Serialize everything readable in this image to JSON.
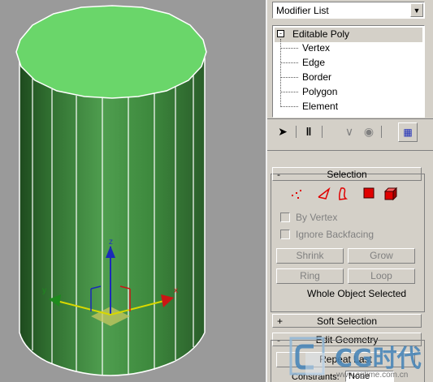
{
  "viewport": {
    "axis_labels": {
      "x": "x",
      "y": "y",
      "z": "z"
    },
    "colors": {
      "object": "#3f8f3f",
      "top": "#6ad66a",
      "background": "#9a9a9a"
    }
  },
  "panel": {
    "modifier_list": {
      "label": "Modifier List"
    },
    "stack": {
      "root": "Editable Poly",
      "items": [
        "Vertex",
        "Edge",
        "Border",
        "Polygon",
        "Element"
      ]
    },
    "toolbar": {
      "icons": [
        "pin-stack-icon",
        "show-end-result-icon",
        "make-unique-icon",
        "remove-modifier-icon",
        "configure-modifier-sets-icon"
      ]
    },
    "selection": {
      "title": "Selection",
      "collapse_sign": "-",
      "subobject_icons": [
        "vertex-icon",
        "edge-icon",
        "border-icon",
        "polygon-icon",
        "element-icon"
      ],
      "by_vertex": "By Vertex",
      "ignore_backfacing": "Ignore Backfacing",
      "shrink": "Shrink",
      "grow": "Grow",
      "ring": "Ring",
      "loop": "Loop",
      "status": "Whole Object Selected"
    },
    "soft_selection": {
      "title": "Soft Selection",
      "collapse_sign": "+"
    },
    "edit_geometry": {
      "title": "Edit Geometry",
      "collapse_sign": "-",
      "repeat_last": "Repeat Last",
      "constraints_label": "Constraints:",
      "constraints_value": "None"
    }
  },
  "watermark": {
    "brand": "CG时代",
    "url": "www.cgtime.com.cn"
  }
}
